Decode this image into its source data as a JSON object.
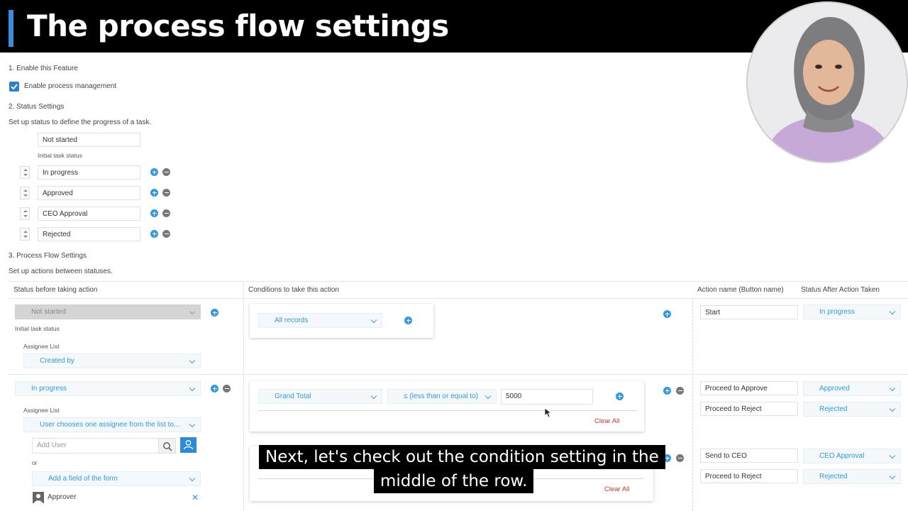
{
  "header": {
    "title": "The process flow settings"
  },
  "section1": {
    "heading": "1. Enable this Feature",
    "checkbox_label": "Enable process management",
    "checked": true
  },
  "section2": {
    "heading": "2. Status Settings",
    "description": "Set up status to define the progress of a task.",
    "initial_status": "Not started",
    "initial_caption": "Initial task status",
    "statuses": [
      "In progress",
      "Approved",
      "CEO Approval",
      "Rejected"
    ]
  },
  "section3": {
    "heading": "3. Process Flow Settings",
    "description": "Set up actions between statuses.",
    "columns": {
      "status_before": "Status before taking action",
      "conditions": "Conditions to take this action",
      "action_name": "Action name (Button name)",
      "status_after": "Status After Action Taken"
    },
    "row1": {
      "status": "Not started",
      "initial_caption": "Initial task status",
      "assignee_label": "Assignee List",
      "assignee": "Created by",
      "condition": "All records",
      "actions": [
        {
          "name": "Start",
          "status": "In progress"
        }
      ]
    },
    "row2": {
      "status": "In progress",
      "assignee_label": "Assignee List",
      "assignee": "User chooses one assignee from the list to...",
      "add_user_placeholder": "Add User",
      "or_label": "or",
      "add_field": "Add a field of the form",
      "approver": "Approver",
      "condition_field": "Grand Total",
      "condition_operator": "≤ (less than or equal to)",
      "condition_value": "5000",
      "clear_all": "Clear All",
      "actions": [
        {
          "name": "Proceed to Approve",
          "status": "Approved"
        },
        {
          "name": "Proceed to Reject",
          "status": "Rejected"
        }
      ]
    },
    "row3": {
      "clear_all": "Clear All",
      "actions": [
        {
          "name": "Send to CEO",
          "status": "CEO Approval"
        },
        {
          "name": "Proceed to Reject",
          "status": "Rejected"
        }
      ]
    }
  },
  "subtitle": {
    "line1": "Next, let's check out the condition setting in the",
    "line2": "middle of the row."
  },
  "colors": {
    "accent": "#3498db",
    "danger": "#c0392b",
    "title_bg": "#000000"
  }
}
